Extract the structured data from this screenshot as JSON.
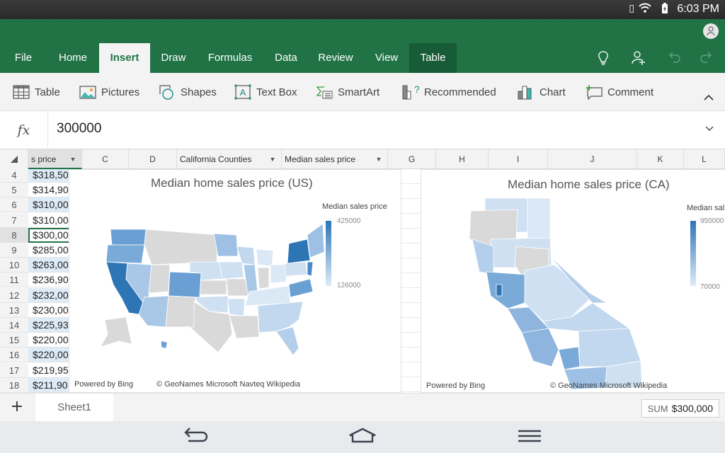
{
  "status_bar": {
    "time": "6:03 PM",
    "icons": [
      "phone-vibrate-icon",
      "wifi-icon",
      "battery-charging-icon"
    ]
  },
  "ribbon_tabs": [
    {
      "label": "File",
      "state": "normal"
    },
    {
      "label": "Home",
      "state": "normal"
    },
    {
      "label": "Insert",
      "state": "active"
    },
    {
      "label": "Draw",
      "state": "normal"
    },
    {
      "label": "Formulas",
      "state": "normal"
    },
    {
      "label": "Data",
      "state": "normal"
    },
    {
      "label": "Review",
      "state": "normal"
    },
    {
      "label": "View",
      "state": "normal"
    },
    {
      "label": "Table",
      "state": "contextual"
    }
  ],
  "ribbon_right_icons": [
    "lightbulb-icon",
    "share-person-icon",
    "undo-icon",
    "redo-icon"
  ],
  "insert_commands": [
    {
      "label": "Table",
      "icon": "table-icon"
    },
    {
      "label": "Pictures",
      "icon": "pictures-icon"
    },
    {
      "label": "Shapes",
      "icon": "shapes-icon"
    },
    {
      "label": "Text Box",
      "icon": "text-box-icon"
    },
    {
      "label": "SmartArt",
      "icon": "smartart-icon"
    },
    {
      "label": "Recommended",
      "icon": "recommended-chart-icon"
    },
    {
      "label": "Chart",
      "icon": "chart-icon"
    },
    {
      "label": "Comment",
      "icon": "comment-icon"
    }
  ],
  "formula_bar": {
    "fx_label": "fx",
    "value": "300000"
  },
  "column_headers": {
    "b": "s price",
    "c": "C",
    "d": "D",
    "e": "California Counties",
    "f": "Median sales price",
    "g": "G",
    "h": "H",
    "i": "I",
    "j": "J",
    "k": "K",
    "l": "L"
  },
  "rows": [
    {
      "num": "4",
      "value": "$318,50"
    },
    {
      "num": "5",
      "value": "$314,90"
    },
    {
      "num": "6",
      "value": "$310,00"
    },
    {
      "num": "7",
      "value": "$310,00"
    },
    {
      "num": "8",
      "value": "$300,00",
      "selected": true
    },
    {
      "num": "9",
      "value": "$285,00"
    },
    {
      "num": "10",
      "value": "$263,00"
    },
    {
      "num": "11",
      "value": "$236,90"
    },
    {
      "num": "12",
      "value": "$232,00"
    },
    {
      "num": "13",
      "value": "$230,00"
    },
    {
      "num": "14",
      "value": "$225,93"
    },
    {
      "num": "15",
      "value": "$220,00"
    },
    {
      "num": "16",
      "value": "$220,00"
    },
    {
      "num": "17",
      "value": "$219,95"
    },
    {
      "num": "18",
      "value": "$211,90"
    }
  ],
  "charts": {
    "us": {
      "title": "Median home sales price (US)",
      "legend_title": "Median sales price",
      "legend_max": "425000",
      "legend_min": "126000",
      "credit_left": "Powered by Bing",
      "credit_right": "© GeoNames Microsoft Navteq Wikipedia"
    },
    "ca": {
      "title": "Median home sales price (CA)",
      "legend_title": "Median sal",
      "legend_max": "950000",
      "legend_min": "70000",
      "credit_left": "Powered by Bing",
      "credit_right": "© GeoNames Microsoft Wikipedia"
    }
  },
  "colors": {
    "brand": "#217346",
    "contextual_tab": "#185c37",
    "map_dark": "#2e75b6",
    "map_light": "#deebf7",
    "no_data": "#d9d9d9"
  },
  "sheet_bar": {
    "add_label": "+",
    "sheets": [
      "Sheet1"
    ],
    "sum_label": "SUM",
    "sum_value": "$300,000"
  },
  "nav_bar": {
    "icons": [
      "back-icon",
      "home-icon",
      "menu-icon"
    ]
  }
}
